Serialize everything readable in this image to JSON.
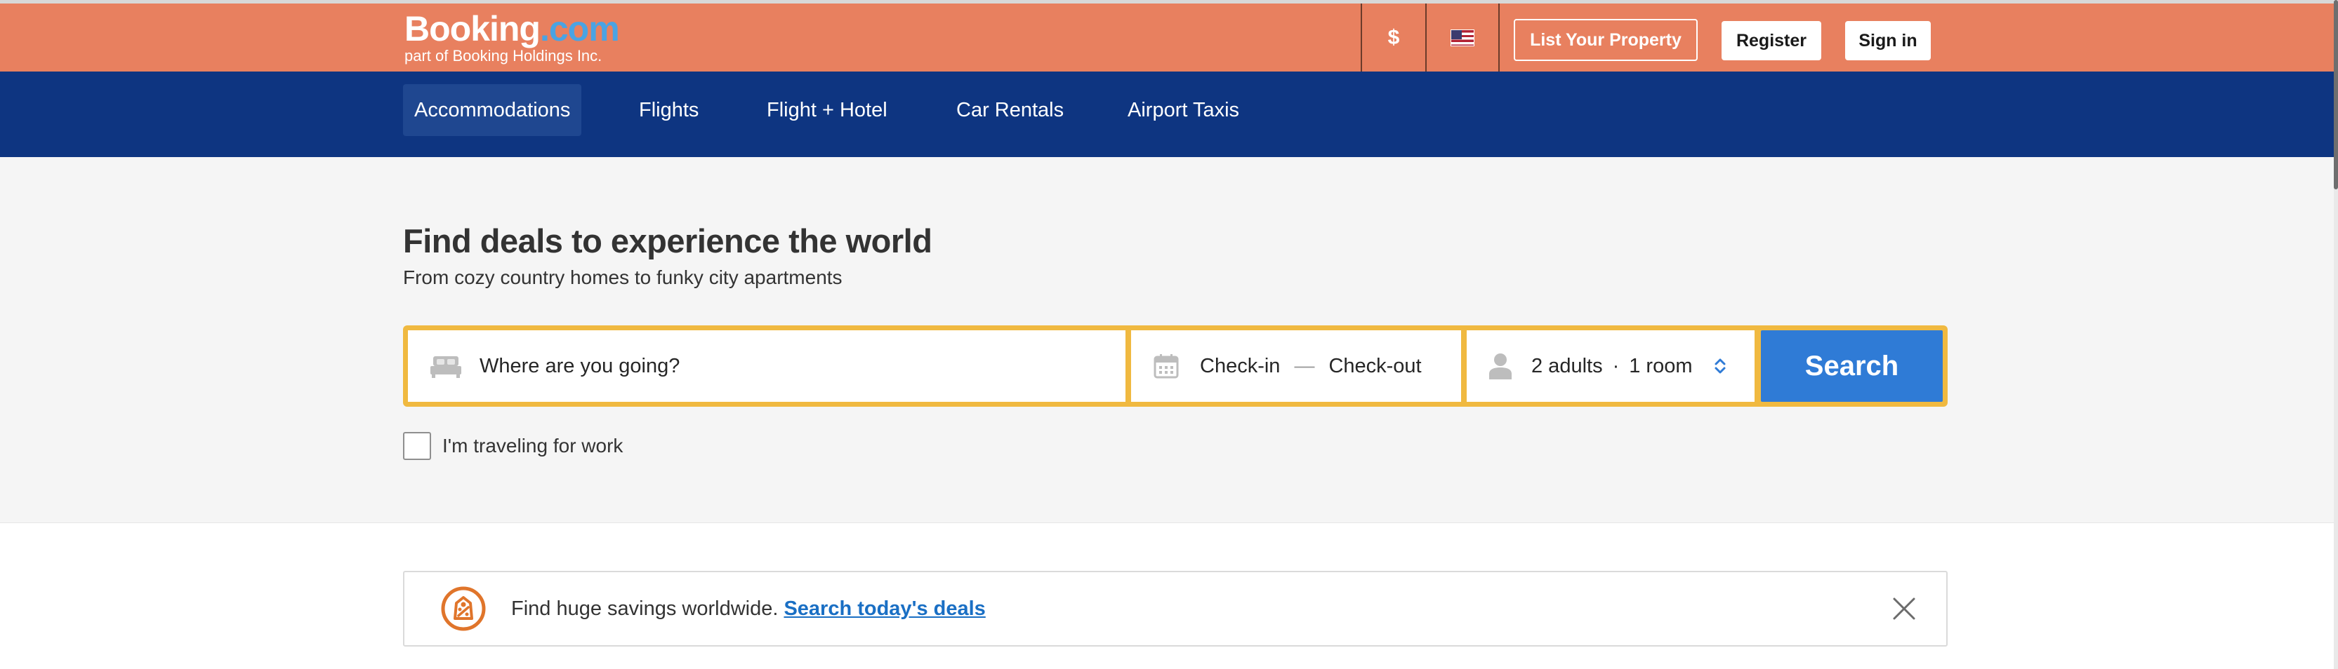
{
  "header": {
    "logo_booking": "Booking",
    "logo_com": ".com",
    "logo_sub": "part of Booking Holdings Inc.",
    "currency": "$",
    "flag_icon": "us-flag-icon",
    "list_property": "List Your Property",
    "register": "Register",
    "sign_in": "Sign in"
  },
  "nav": {
    "items": [
      {
        "label": "Accommodations",
        "active": true
      },
      {
        "label": "Flights",
        "active": false
      },
      {
        "label": "Flight + Hotel",
        "active": false
      },
      {
        "label": "Car Rentals",
        "active": false
      },
      {
        "label": "Airport Taxis",
        "active": false
      }
    ]
  },
  "hero": {
    "title": "Find deals to experience the world",
    "subtitle": "From cozy country homes to funky city apartments"
  },
  "search": {
    "destination_placeholder": "Where are you going?",
    "checkin": "Check-in",
    "dash": "—",
    "checkout": "Check-out",
    "adults": "2 adults",
    "dot": "·",
    "rooms": "1 room",
    "button": "Search",
    "work_label": "I'm traveling for work"
  },
  "deals": {
    "text": "Find huge savings worldwide.",
    "link": "Search today's deals"
  },
  "colors": {
    "header_bg": "#e8805f",
    "nav_bg": "#0e3581",
    "search_border": "#f0b940",
    "search_button": "#2f7bd6",
    "link": "#1a6fc4"
  }
}
